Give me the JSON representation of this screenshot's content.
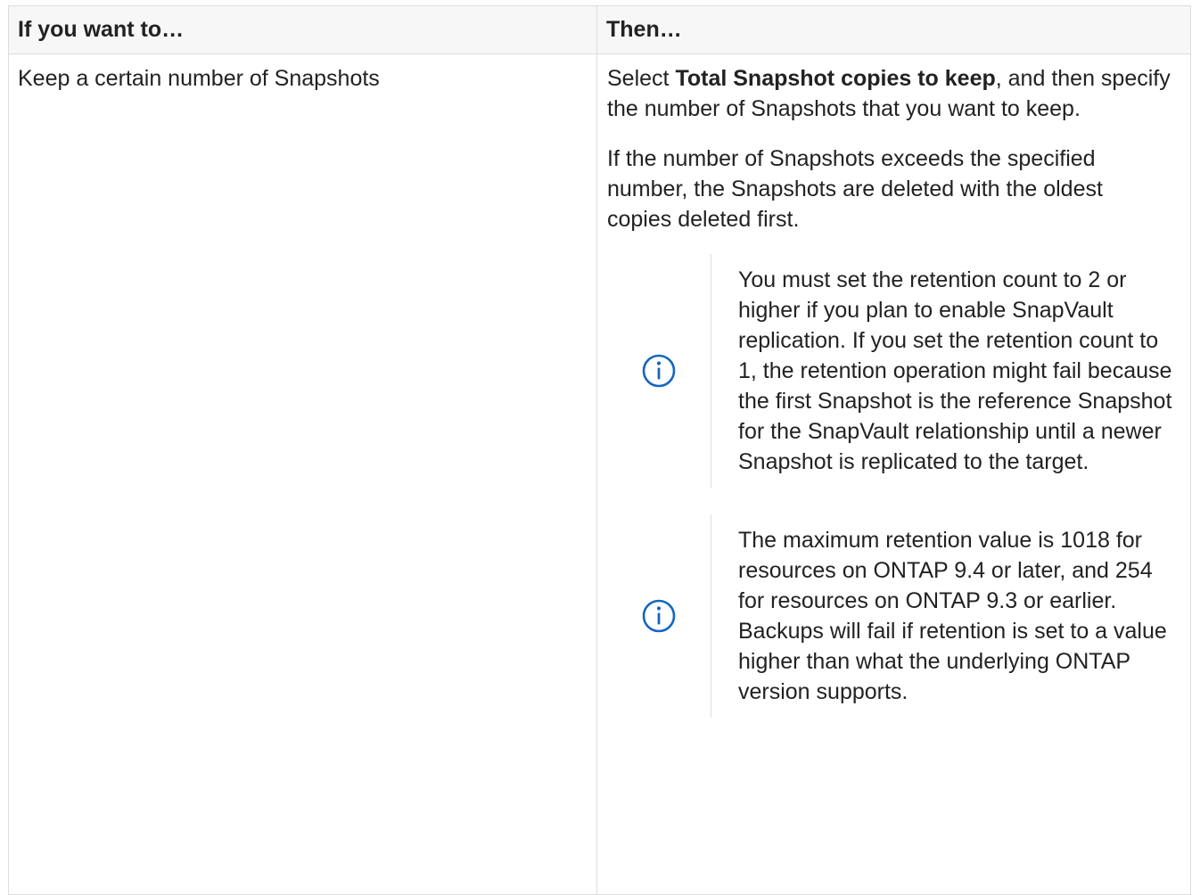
{
  "table": {
    "headers": [
      "If you want to…",
      "Then…"
    ],
    "row": {
      "condition": "Keep a certain number of Snapshots",
      "action_prefix": "Select ",
      "action_bold": "Total Snapshot copies to keep",
      "action_suffix": ", and then specify the number of Snapshots that you want to keep.",
      "paragraph2": "If the number of Snapshots exceeds the specified number, the Snapshots are deleted with the oldest copies deleted first.",
      "notes": [
        {
          "icon": "info-icon",
          "text": "You must set the retention count to 2 or higher if you plan to enable SnapVault replication. If you set the retention count to 1, the retention operation might fail because the first Snapshot is the reference Snapshot for the SnapVault relationship until a newer Snapshot is replicated to the target."
        },
        {
          "icon": "info-icon",
          "text": "The maximum retention value is 1018 for resources on ONTAP 9.4 or later, and 254 for resources on ONTAP 9.3 or earlier. Backups will fail if retention is set to a value higher than what the underlying ONTAP version supports."
        }
      ]
    }
  },
  "colors": {
    "text": "#222222",
    "header_bg": "#f7f7f7",
    "border": "#dddddd",
    "icon": "#1565c0"
  }
}
